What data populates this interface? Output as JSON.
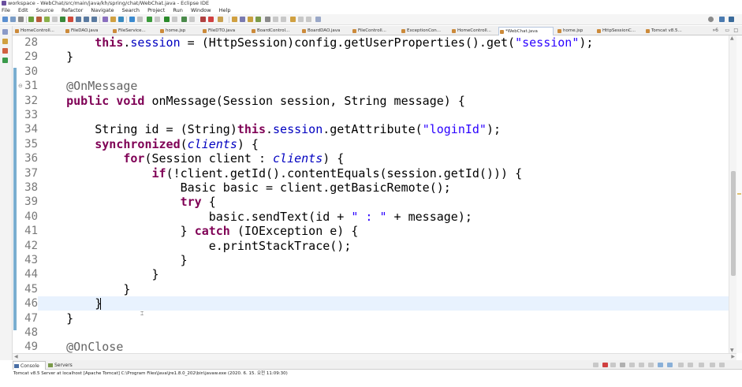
{
  "window": {
    "title": "workspace - WebChat/src/main/java/kh/spring/chat/WebChat.java - Eclipse IDE"
  },
  "menu": [
    "File",
    "Edit",
    "Source",
    "Refactor",
    "Navigate",
    "Search",
    "Project",
    "Run",
    "Window",
    "Help"
  ],
  "toolbar": {
    "icons": [
      "new-icon",
      "save-icon",
      "print-icon",
      "debug-icon",
      "run-icon",
      "search-icon",
      "quick-access-icon"
    ]
  },
  "editor_tabs": [
    {
      "label": "HomeControll..."
    },
    {
      "label": "FileDAO.java"
    },
    {
      "label": "FileService..."
    },
    {
      "label": "home.jsp"
    },
    {
      "label": "FileDTO.java"
    },
    {
      "label": "BoardControl..."
    },
    {
      "label": "BoardDAO.java"
    },
    {
      "label": "FileControll..."
    },
    {
      "label": "ExceptionCon..."
    },
    {
      "label": "HomeControll..."
    },
    {
      "label": "*WebChat.java",
      "active": true
    },
    {
      "label": "home.jsp"
    },
    {
      "label": "HttpSessionC..."
    },
    {
      "label": "Tomcat v8.5..."
    }
  ],
  "tabs_overflow": "»6",
  "editor": {
    "line_numbers": [
      "28",
      "29",
      "30",
      "31",
      "32",
      "33",
      "34",
      "35",
      "36",
      "37",
      "38",
      "39",
      "40",
      "41",
      "42",
      "43",
      "44",
      "45",
      "46",
      "47",
      "48",
      "49"
    ],
    "fold_lines": [
      "31"
    ],
    "current_line": "46"
  },
  "console": {
    "tabs": [
      {
        "label": "Console",
        "active": true
      },
      {
        "label": "Servers"
      }
    ],
    "status": "Tomcat v8.5 Server at localhost [Apache Tomcat] C:\\Program Files\\Java\\jre1.8.0_202\\bin\\javaw.exe (2020. 6. 15. 오전 11:09:30)"
  },
  "colors": {
    "keyword": "#7f0055",
    "field": "#0000c0",
    "string": "#2a00ff",
    "annotation": "#646464",
    "current_line_bg": "#e8f2fe",
    "ruler_mark": "#7aaed0"
  }
}
